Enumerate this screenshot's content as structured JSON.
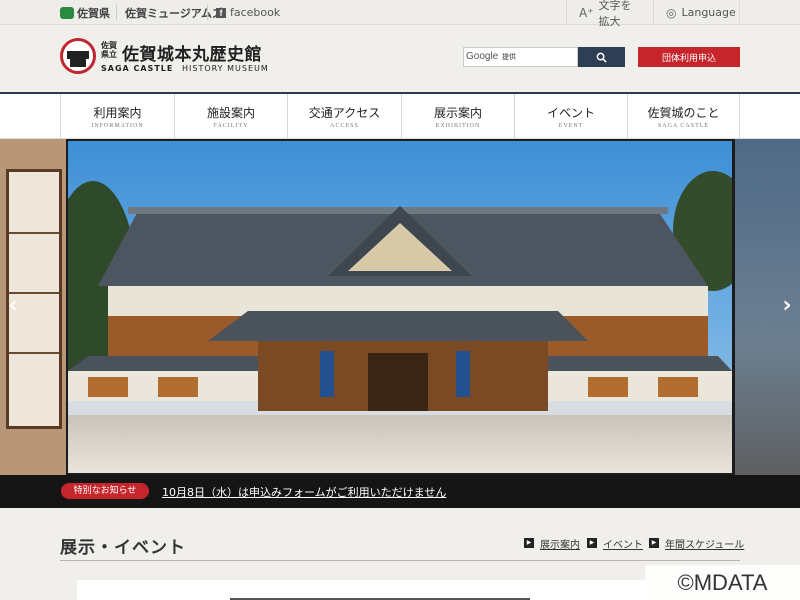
{
  "topbar": {
    "pref_label": "佐賀県",
    "museum_label": "佐賀ミュージアムズ",
    "facebook_label": "facebook",
    "font_size_label": "文字を拡大",
    "language_label": "Language"
  },
  "header": {
    "logo_ken": "佐賀県立",
    "logo_name": "佐賀城本丸歴史館",
    "logo_en_bold": "SAGA CASTLE",
    "logo_en_light": "HISTORY MUSEUM",
    "search_brand": "Google",
    "search_value": "提供",
    "group_button": "団体利用申込"
  },
  "nav": {
    "items": [
      {
        "jp": "利用案内",
        "en": "INFORMATION"
      },
      {
        "jp": "施設案内",
        "en": "FACILITY"
      },
      {
        "jp": "交通アクセス",
        "en": "ACCESS"
      },
      {
        "jp": "展示案内",
        "en": "EXHIBITION"
      },
      {
        "jp": "イベント",
        "en": "EVENT"
      },
      {
        "jp": "佐賀城のこと",
        "en": "SAGA CASTLE"
      }
    ]
  },
  "hero": {
    "prev_icon": "chevron-left-icon",
    "next_icon": "chevron-right-icon"
  },
  "notice": {
    "badge": "特別なお知らせ",
    "text": "10月8日（水）は申込みフォームがご利用いただけません"
  },
  "section": {
    "title": "展示・イベント",
    "links": [
      "展示案内",
      "イベント",
      "年間スケジュール"
    ]
  },
  "watermark": "©MDATA",
  "colors": {
    "accent_red": "#c6252c",
    "navy": "#2e3f55",
    "background": "#f1efec"
  }
}
